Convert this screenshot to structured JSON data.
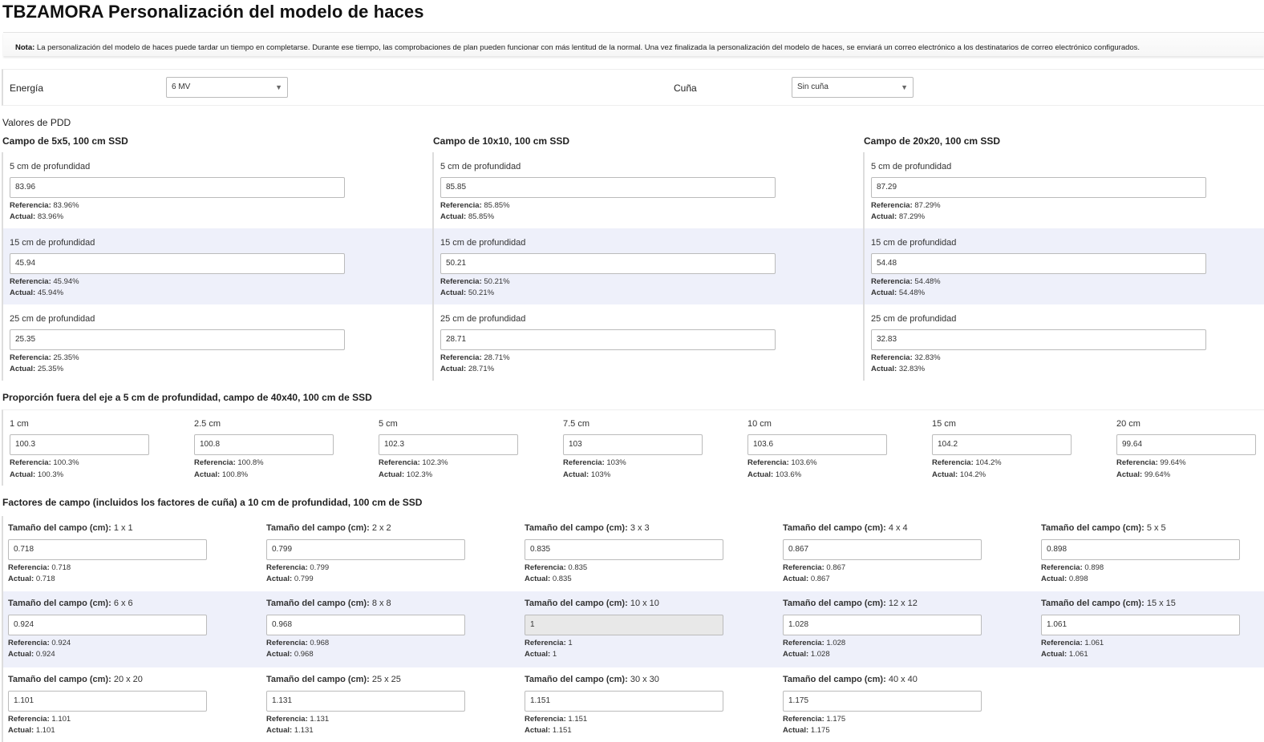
{
  "header": {
    "title": "TBZAMORA Personalización del modelo de haces"
  },
  "note": {
    "label": "Nota:",
    "text": " La personalización del modelo de haces puede tardar un tiempo en completarse. Durante ese tiempo, las comprobaciones de plan pueden funcionar con más lentitud de la normal. Una vez finalizada la personalización del modelo de haces, se enviará un correo electrónico a los destinatarios de correo electrónico configurados."
  },
  "selectors": {
    "energy_label": "Energía",
    "energy_value": "6 MV",
    "wedge_label": "Cuña",
    "wedge_value": "Sin cuña",
    "arrow": "▼"
  },
  "labels": {
    "reference": "Referencia:",
    "actual": "Actual:",
    "field_size": "Tamaño del campo (cm):"
  },
  "pdd": {
    "title": "Valores de PDD",
    "columns": [
      {
        "title": "Campo de 5x5, 100 cm SSD",
        "rows": [
          {
            "label": "5 cm de profundidad",
            "value": "83.96",
            "reference": "83.96%",
            "actual": "83.96%"
          },
          {
            "label": "15 cm de profundidad",
            "value": "45.94",
            "reference": "45.94%",
            "actual": "45.94%"
          },
          {
            "label": "25 cm de profundidad",
            "value": "25.35",
            "reference": "25.35%",
            "actual": "25.35%"
          }
        ]
      },
      {
        "title": "Campo de 10x10, 100 cm SSD",
        "rows": [
          {
            "label": "5 cm de profundidad",
            "value": "85.85",
            "reference": "85.85%",
            "actual": "85.85%"
          },
          {
            "label": "15 cm de profundidad",
            "value": "50.21",
            "reference": "50.21%",
            "actual": "50.21%"
          },
          {
            "label": "25 cm de profundidad",
            "value": "28.71",
            "reference": "28.71%",
            "actual": "28.71%"
          }
        ]
      },
      {
        "title": "Campo de 20x20, 100 cm SSD",
        "rows": [
          {
            "label": "5 cm de profundidad",
            "value": "87.29",
            "reference": "87.29%",
            "actual": "87.29%"
          },
          {
            "label": "15 cm de profundidad",
            "value": "54.48",
            "reference": "54.48%",
            "actual": "54.48%"
          },
          {
            "label": "25 cm de profundidad",
            "value": "32.83",
            "reference": "32.83%",
            "actual": "32.83%"
          }
        ]
      }
    ]
  },
  "off_axis": {
    "title": "Proporción fuera del eje a 5 cm de profundidad, campo de 40x40, 100 cm de SSD",
    "items": [
      {
        "label": "1 cm",
        "value": "100.3",
        "reference": "100.3%",
        "actual": "100.3%"
      },
      {
        "label": "2.5 cm",
        "value": "100.8",
        "reference": "100.8%",
        "actual": "100.8%"
      },
      {
        "label": "5 cm",
        "value": "102.3",
        "reference": "102.3%",
        "actual": "102.3%"
      },
      {
        "label": "7.5 cm",
        "value": "103",
        "reference": "103%",
        "actual": "103%"
      },
      {
        "label": "10 cm",
        "value": "103.6",
        "reference": "103.6%",
        "actual": "103.6%"
      },
      {
        "label": "15 cm",
        "value": "104.2",
        "reference": "104.2%",
        "actual": "104.2%"
      },
      {
        "label": "20 cm",
        "value": "99.64",
        "reference": "99.64%",
        "actual": "99.64%"
      }
    ]
  },
  "field_factors": {
    "title": "Factores de campo (incluidos los factores de cuña) a 10 cm de profundidad, 100 cm de SSD",
    "items": [
      {
        "size": "1 x 1",
        "value": "0.718",
        "reference": "0.718",
        "actual": "0.718"
      },
      {
        "size": "2 x 2",
        "value": "0.799",
        "reference": "0.799",
        "actual": "0.799"
      },
      {
        "size": "3 x 3",
        "value": "0.835",
        "reference": "0.835",
        "actual": "0.835"
      },
      {
        "size": "4 x 4",
        "value": "0.867",
        "reference": "0.867",
        "actual": "0.867"
      },
      {
        "size": "5 x 5",
        "value": "0.898",
        "reference": "0.898",
        "actual": "0.898"
      },
      {
        "size": "6 x 6",
        "value": "0.924",
        "reference": "0.924",
        "actual": "0.924"
      },
      {
        "size": "8 x 8",
        "value": "0.968",
        "reference": "0.968",
        "actual": "0.968"
      },
      {
        "size": "10 x 10",
        "value": "1",
        "reference": "1",
        "actual": "1",
        "readonly": true
      },
      {
        "size": "12 x 12",
        "value": "1.028",
        "reference": "1.028",
        "actual": "1.028"
      },
      {
        "size": "15 x 15",
        "value": "1.061",
        "reference": "1.061",
        "actual": "1.061"
      },
      {
        "size": "20 x 20",
        "value": "1.101",
        "reference": "1.101",
        "actual": "1.101"
      },
      {
        "size": "25 x 25",
        "value": "1.131",
        "reference": "1.131",
        "actual": "1.131"
      },
      {
        "size": "30 x 30",
        "value": "1.151",
        "reference": "1.151",
        "actual": "1.151"
      },
      {
        "size": "40 x 40",
        "value": "1.175",
        "reference": "1.175",
        "actual": "1.175"
      }
    ]
  }
}
